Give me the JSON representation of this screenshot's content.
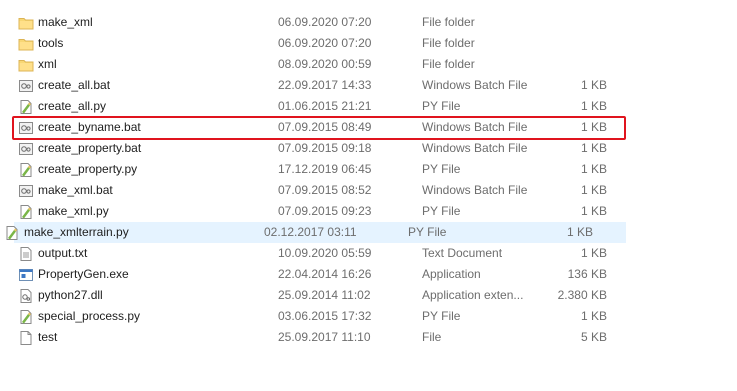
{
  "files": [
    {
      "name": "make_xml",
      "date": "06.09.2020 07:20",
      "type": "File folder",
      "size": "",
      "icon": "folder-icon"
    },
    {
      "name": "tools",
      "date": "06.09.2020 07:20",
      "type": "File folder",
      "size": "",
      "icon": "folder-icon"
    },
    {
      "name": "xml",
      "date": "08.09.2020 00:59",
      "type": "File folder",
      "size": "",
      "icon": "folder-icon"
    },
    {
      "name": "create_all.bat",
      "date": "22.09.2017 14:33",
      "type": "Windows Batch File",
      "size": "1 KB",
      "icon": "batch-file-icon"
    },
    {
      "name": "create_all.py",
      "date": "01.06.2015 21:21",
      "type": "PY File",
      "size": "1 KB",
      "icon": "python-file-icon"
    },
    {
      "name": "create_byname.bat",
      "date": "07.09.2015 08:49",
      "type": "Windows Batch File",
      "size": "1 KB",
      "icon": "batch-file-icon"
    },
    {
      "name": "create_property.bat",
      "date": "07.09.2015 09:18",
      "type": "Windows Batch File",
      "size": "1 KB",
      "icon": "batch-file-icon"
    },
    {
      "name": "create_property.py",
      "date": "17.12.2019 06:45",
      "type": "PY File",
      "size": "1 KB",
      "icon": "python-file-icon"
    },
    {
      "name": "make_xml.bat",
      "date": "07.09.2015 08:52",
      "type": "Windows Batch File",
      "size": "1 KB",
      "icon": "batch-file-icon"
    },
    {
      "name": "make_xml.py",
      "date": "07.09.2015 09:23",
      "type": "PY File",
      "size": "1 KB",
      "icon": "python-file-icon"
    },
    {
      "name": "make_xmlterrain.py",
      "date": "02.12.2017 03:11",
      "type": "PY File",
      "size": "1 KB",
      "icon": "python-file-icon"
    },
    {
      "name": "output.txt",
      "date": "10.09.2020 05:59",
      "type": "Text Document",
      "size": "1 KB",
      "icon": "text-file-icon"
    },
    {
      "name": "PropertyGen.exe",
      "date": "22.04.2014 16:26",
      "type": "Application",
      "size": "136 KB",
      "icon": "application-icon"
    },
    {
      "name": "python27.dll",
      "date": "25.09.2014 11:02",
      "type": "Application exten...",
      "size": "2.380 KB",
      "icon": "dll-file-icon"
    },
    {
      "name": "special_process.py",
      "date": "03.06.2015 17:32",
      "type": "PY File",
      "size": "1 KB",
      "icon": "python-file-icon"
    },
    {
      "name": "test",
      "date": "25.09.2017 11:10",
      "type": "File",
      "size": "5 KB",
      "icon": "generic-file-icon"
    }
  ],
  "hovered_file": "make_xmlterrain.py",
  "highlighted_file": "create_byname.bat",
  "colors": {
    "highlight_border": "#e0141e",
    "hover_background": "#e5f3ff",
    "folder": "#f8d775"
  }
}
